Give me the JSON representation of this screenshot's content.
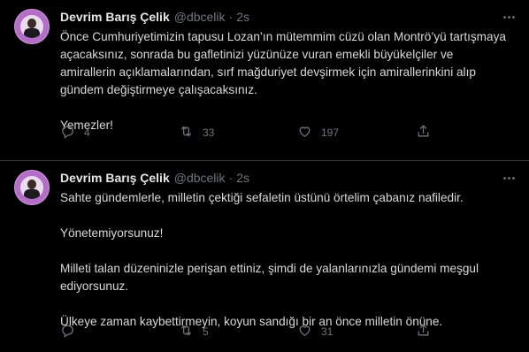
{
  "tweets": [
    {
      "author": "Devrim Barış Çelik",
      "handle": "@dbcelik",
      "separator": "·",
      "time": "2s",
      "paragraphs": [
        "Önce Cumhuriyetimizin tapusu Lozan’ın mütemmim cüzü olan Montrö’yü tartışmaya açacaksınız, sonrada bu gafletinizi yüzünüze vuran emekli büyükelçiler ve amirallerin açıklamalarından, sırf mağduriyet devşirmek için amirallerinkini alıp gündem değiştirmeye çalışacaksınız.",
        "Yemezler!"
      ],
      "replies": "4",
      "retweets": "33",
      "likes": "197"
    },
    {
      "author": "Devrim Barış Çelik",
      "handle": "@dbcelik",
      "separator": "·",
      "time": "2s",
      "paragraphs": [
        "Sahte gündemlerle, milletin çektiği sefaletin üstünü örtelim çabanız nafiledir.",
        "Yönetemiyorsunuz!",
        "Milleti talan düzeninizle perişan ettiniz, şimdi de yalanlarınızla gündemi meşgul ediyorsunuz.",
        "Ülkeye zaman kaybettirmeyin, koyun sandığı bir an önce milletin önüne."
      ],
      "replies": "",
      "retweets": "5",
      "likes": "31"
    }
  ],
  "colors": {
    "background": "#000000",
    "text": "#d9d9d9",
    "muted": "#6e767d",
    "divider": "#2f3336",
    "avatar_ring": "#b46dc8"
  },
  "icons": {
    "reply": "reply-icon",
    "retweet": "retweet-icon",
    "like": "heart-icon",
    "share": "share-icon",
    "more": "more-icon"
  }
}
